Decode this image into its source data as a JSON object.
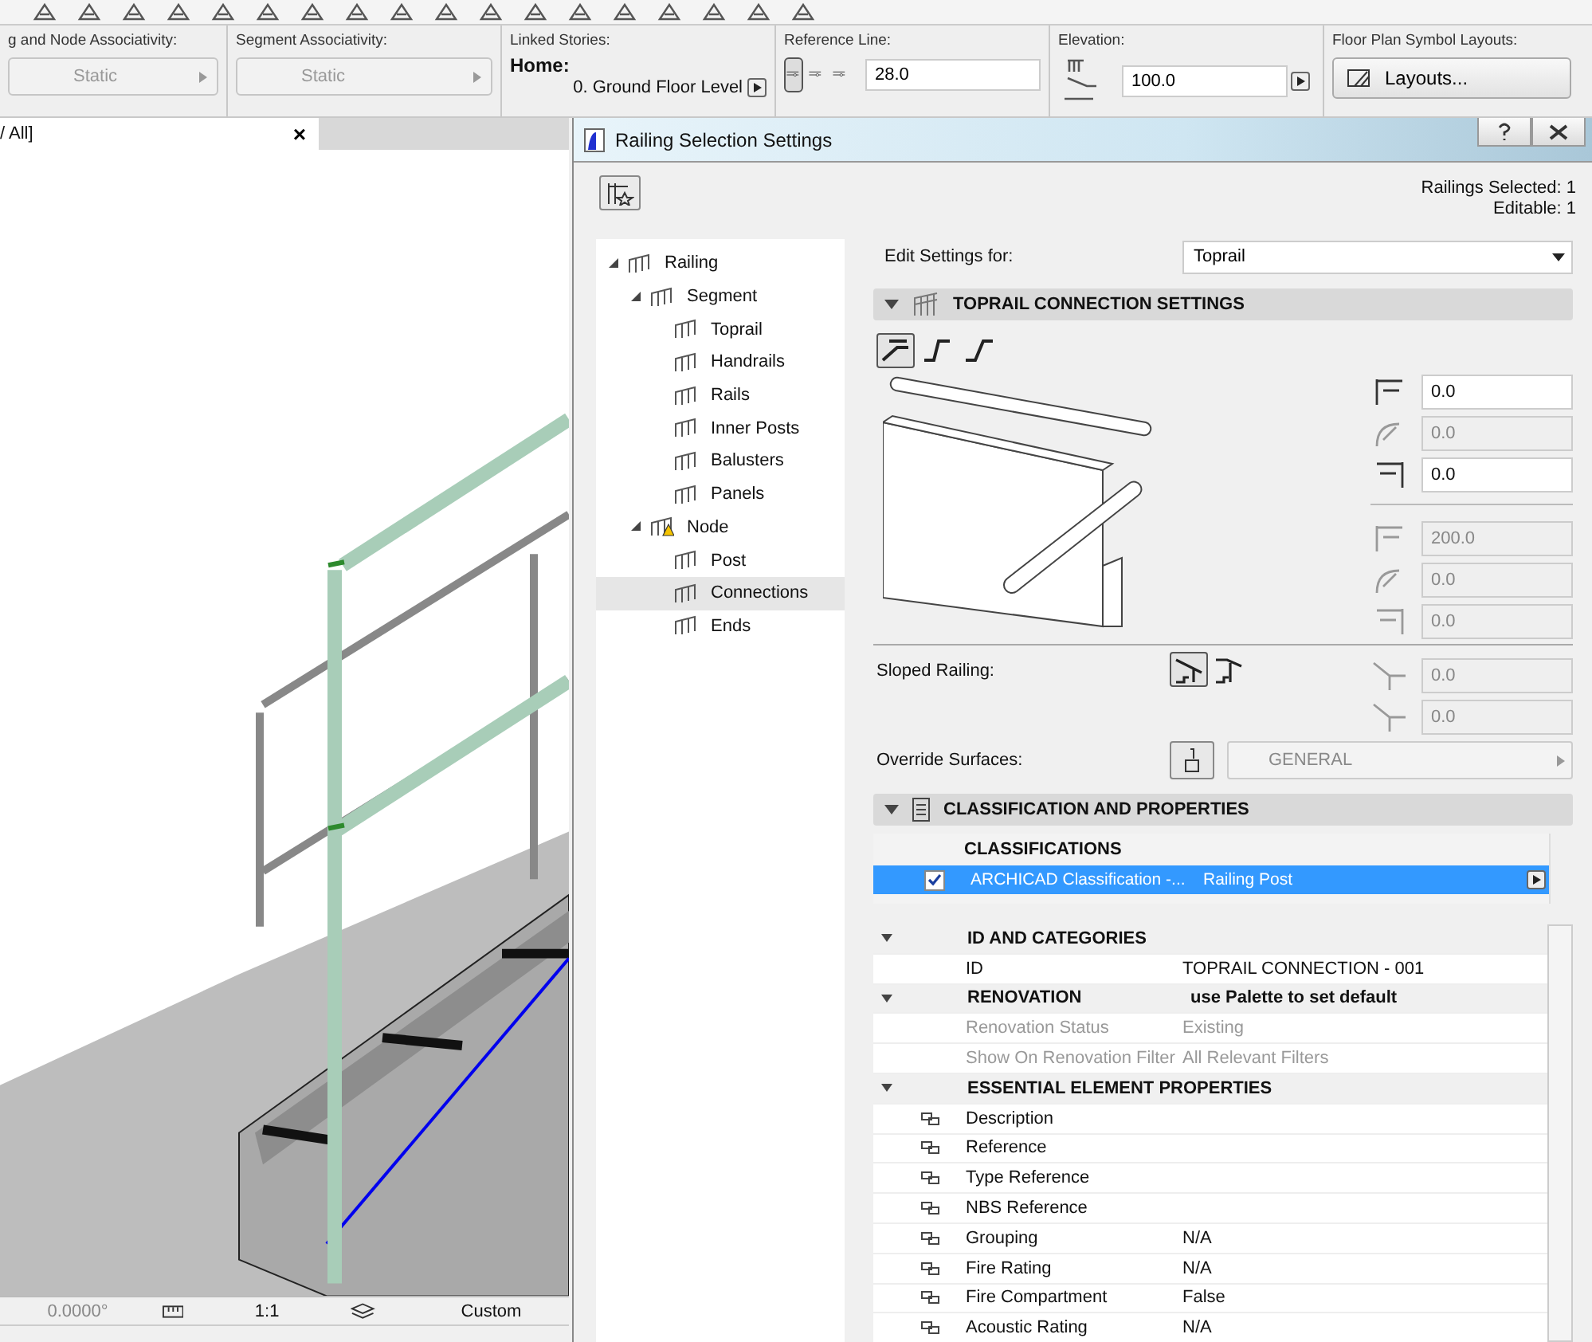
{
  "info_bar": {
    "node_associativity": {
      "label": "g and Node Associativity:",
      "value": "Static"
    },
    "segment_associativity": {
      "label": "Segment Associativity:",
      "value": "Static"
    },
    "linked_stories": {
      "label": "Linked Stories:",
      "home_label": "Home:",
      "story": "0. Ground Floor Level"
    },
    "reference_line": {
      "label": "Reference Line:",
      "value": "28.0",
      "options": [
        {
          "selected": true
        },
        {
          "selected": false
        },
        {
          "selected": false
        }
      ]
    },
    "elevation": {
      "label": "Elevation:",
      "value": "100.0"
    },
    "floor_plan_layouts": {
      "label": "Floor Plan Symbol Layouts:",
      "button": "Layouts..."
    }
  },
  "view_tab": {
    "title": "/ All]",
    "close": "×"
  },
  "status_bar": {
    "angle": "0.0000°",
    "scale": "1:1",
    "layer": "Custom"
  },
  "dialog": {
    "title": "Railing Selection Settings",
    "selection_info": [
      "Railings Selected: 1",
      "Editable: 1"
    ],
    "tree": [
      {
        "label": "Railing",
        "expanded": true,
        "selected": false,
        "warning": false,
        "children": [
          {
            "label": "Segment",
            "expanded": true,
            "selected": false,
            "warning": false,
            "children": [
              {
                "label": "Toprail",
                "selected": false
              },
              {
                "label": "Handrails",
                "selected": false
              },
              {
                "label": "Rails",
                "selected": false
              },
              {
                "label": "Inner Posts",
                "selected": false
              },
              {
                "label": "Balusters",
                "selected": false
              },
              {
                "label": "Panels",
                "selected": false
              }
            ]
          },
          {
            "label": "Node",
            "expanded": true,
            "selected": false,
            "warning": true,
            "children": [
              {
                "label": "Post",
                "selected": false
              },
              {
                "label": "Connections",
                "selected": true
              },
              {
                "label": "Ends",
                "selected": false
              }
            ]
          }
        ]
      }
    ],
    "edit_settings_for": {
      "label": "Edit Settings for:",
      "value": "Toprail"
    },
    "toprail_panel": {
      "title": "TOPRAIL CONNECTION SETTINGS",
      "expanded": true,
      "connection_types": [
        {
          "selected": true
        },
        {
          "selected": false
        },
        {
          "selected": false
        }
      ],
      "fields": [
        {
          "value": "0.0",
          "disabled": false
        },
        {
          "value": "0.0",
          "disabled": true
        },
        {
          "value": "0.0",
          "disabled": false
        },
        {
          "value": "200.0",
          "disabled": true
        },
        {
          "value": "0.0",
          "disabled": true
        },
        {
          "value": "0.0",
          "disabled": true
        }
      ],
      "sloped_railing": {
        "label": "Sloped Railing:",
        "options": [
          {
            "selected": true
          },
          {
            "selected": false
          }
        ],
        "fields": [
          {
            "value": "0.0",
            "disabled": true
          },
          {
            "value": "0.0",
            "disabled": true
          }
        ]
      },
      "override_surfaces": {
        "label": "Override Surfaces:",
        "value": "GENERAL",
        "disabled": true
      }
    },
    "classification_panel": {
      "title": "CLASSIFICATION AND PROPERTIES",
      "expanded": true,
      "classifications": {
        "heading": "CLASSIFICATIONS",
        "rows": [
          {
            "checked": true,
            "selected": true,
            "system": "ARCHICAD Classification -...",
            "value": "Railing Post"
          }
        ]
      },
      "groups": [
        {
          "title": "ID AND CATEGORIES",
          "expanded": true,
          "rows": [
            {
              "name": "ID",
              "value": "TOPRAIL CONNECTION - 001",
              "disabled": false,
              "linked": false
            }
          ]
        },
        {
          "title": "RENOVATION",
          "value": "use Palette to set default",
          "expanded": true,
          "rows": [
            {
              "name": "Renovation Status",
              "value": "Existing",
              "disabled": true,
              "linked": false
            },
            {
              "name": "Show On Renovation Filter",
              "value": "All Relevant Filters",
              "disabled": true,
              "linked": false
            }
          ]
        },
        {
          "title": "ESSENTIAL ELEMENT PROPERTIES",
          "expanded": true,
          "rows": [
            {
              "name": "Description",
              "disabled": false,
              "linked": true
            },
            {
              "name": "Reference",
              "disabled": false,
              "linked": true
            },
            {
              "name": "Type Reference",
              "disabled": false,
              "linked": true
            },
            {
              "name": "NBS Reference",
              "disabled": false,
              "linked": true
            },
            {
              "name": "Grouping",
              "value": "N/A",
              "disabled": false,
              "linked": true
            },
            {
              "name": "Fire Rating",
              "value": "N/A",
              "disabled": false,
              "linked": true
            },
            {
              "name": "Fire Compartment",
              "value": "False",
              "disabled": false,
              "linked": true
            },
            {
              "name": "Acoustic Rating",
              "value": "N/A",
              "disabled": false,
              "linked": true
            }
          ]
        }
      ]
    }
  }
}
